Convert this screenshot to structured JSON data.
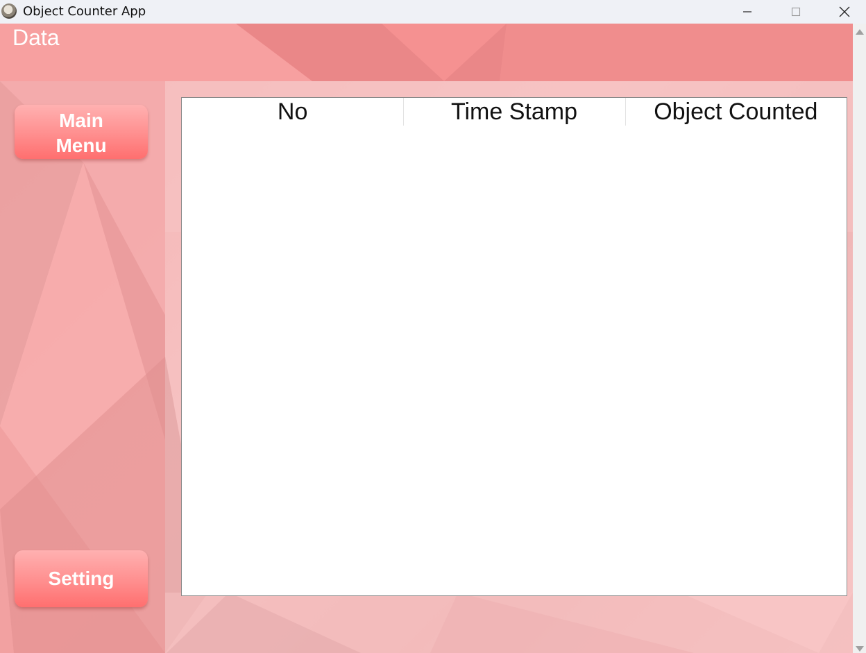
{
  "window": {
    "title": "Object Counter App",
    "icon": "app-avatar-icon",
    "controls": [
      "minimize-icon",
      "maximize-icon",
      "close-icon"
    ]
  },
  "header": {
    "title": "Data"
  },
  "sidebar": {
    "main_menu_label": "Main Menu",
    "setting_label": "Setting"
  },
  "table": {
    "columns": [
      "No",
      "Time Stamp",
      "Object Counted"
    ],
    "rows": []
  },
  "colors": {
    "header_bg": "#f08b8b",
    "button_top": "#ffb1b1",
    "button_bottom": "#ff6f6f",
    "background": "#f3b1b1"
  }
}
